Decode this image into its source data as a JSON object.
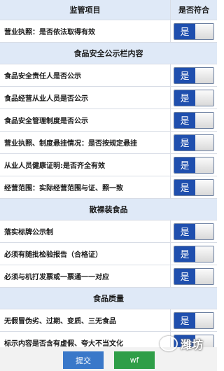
{
  "header": {
    "item_label": "监管项目",
    "status_label": "是否符合"
  },
  "rows": [
    {
      "type": "item",
      "text": "营业执照：是否依法取得有效",
      "value": "是"
    },
    {
      "type": "section",
      "text": "食品安全公示栏内容"
    },
    {
      "type": "item",
      "text": "食品安全责任人是否公示",
      "value": "是"
    },
    {
      "type": "item",
      "text": "食品经营从业人员是否公示",
      "value": "是"
    },
    {
      "type": "item",
      "text": "食品安全管理制度是否公示",
      "value": "是"
    },
    {
      "type": "item",
      "text": "营业执照、制度悬挂情况：是否按规定悬挂",
      "value": "是"
    },
    {
      "type": "item",
      "text": "从业人员健康证明:是否齐全有效",
      "value": "是"
    },
    {
      "type": "item",
      "text": "经营范围：实际经营范围与证、照一致",
      "value": "是"
    },
    {
      "type": "section",
      "text": "散裸装食品"
    },
    {
      "type": "item",
      "text": "落实标牌公示制",
      "value": "是"
    },
    {
      "type": "item",
      "text": "必须有随批检验报告（合格证）",
      "value": "是"
    },
    {
      "type": "item",
      "text": "必须与机打发票或一票通一一对应",
      "value": "是"
    },
    {
      "type": "section",
      "text": "食品质量"
    },
    {
      "type": "item",
      "text": "无假冒伪劣、过期、变质、三无食品",
      "value": "是"
    },
    {
      "type": "item",
      "text": "标示内容是否含有虚假、夸大不当文化",
      "value": "是"
    }
  ],
  "buttons": {
    "submit": "提交",
    "check": "wf"
  },
  "watermark": {
    "text": "潍坊"
  }
}
